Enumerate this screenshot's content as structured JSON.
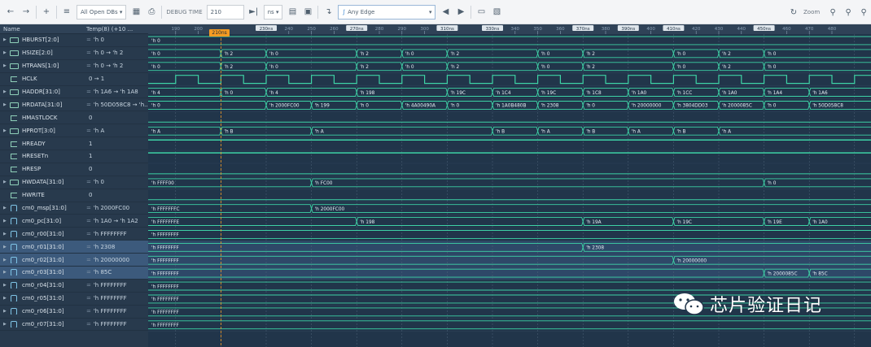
{
  "toolbar": {
    "open_dbs": "All Open DBs",
    "debug_time_label": "DEBUG TIME",
    "debug_time_value": "210",
    "unit": "ns",
    "edge_mode": "Any Edge",
    "zoom_label": "Zoom"
  },
  "header": {
    "name": "Name",
    "value": "Temp(8) (+10 ..."
  },
  "cursor": "210ns",
  "ruler_markers": [
    "230ns",
    "270ns",
    "310ns",
    "330ns",
    "370ns",
    "390ns",
    "410ns",
    "450ns"
  ],
  "ruler_ticks": [
    "190",
    "200",
    "240",
    "250",
    "260",
    "280",
    "290",
    "300",
    "340",
    "350",
    "360",
    "380",
    "400",
    "420",
    "430",
    "440",
    "460",
    "470",
    "480"
  ],
  "signals": [
    {
      "name": "HBURST[2:0]",
      "value": "'h 0",
      "kind": "bus",
      "radix": "=",
      "expand": true
    },
    {
      "name": "HSIZE[2:0]",
      "value": "'h 0 → 'h 2",
      "kind": "bus",
      "radix": "=",
      "expand": true
    },
    {
      "name": "HTRANS[1:0]",
      "value": "'h 0 → 'h 2",
      "kind": "bus",
      "radix": "=",
      "expand": true
    },
    {
      "name": "HCLK",
      "value": "0 → 1",
      "kind": "bit",
      "radix": "",
      "expand": false
    },
    {
      "name": "HADDR[31:0]",
      "value": "'h 1A6 → 'h 1A8",
      "kind": "bus",
      "radix": "=",
      "expand": true
    },
    {
      "name": "HRDATA[31:0]",
      "value": "'h 50D058C8 → 'h...",
      "kind": "bus",
      "radix": "=",
      "expand": true
    },
    {
      "name": "HMASTLOCK",
      "value": "0",
      "kind": "bit",
      "radix": "",
      "expand": false
    },
    {
      "name": "HPROT[3:0]",
      "value": "'h A",
      "kind": "bus",
      "radix": "=",
      "expand": true
    },
    {
      "name": "HREADY",
      "value": "1",
      "kind": "bit",
      "radix": "",
      "expand": false
    },
    {
      "name": "HRESETn",
      "value": "1",
      "kind": "bit",
      "radix": "",
      "expand": false
    },
    {
      "name": "HRESP",
      "value": "0",
      "kind": "bit",
      "radix": "",
      "expand": false
    },
    {
      "name": "HWDATA[31:0]",
      "value": "'h 0",
      "kind": "bus",
      "radix": "=",
      "expand": true
    },
    {
      "name": "HWRITE",
      "value": "0",
      "kind": "bit",
      "radix": "",
      "expand": false
    },
    {
      "name": "cm0_msp[31:0]",
      "value": "'h 2000FC00",
      "kind": "reg",
      "radix": "=",
      "expand": true
    },
    {
      "name": "cm0_pc[31:0]",
      "value": "'h 1A0 → 'h 1A2",
      "kind": "reg",
      "radix": "=",
      "expand": true
    },
    {
      "name": "cm0_r00[31:0]",
      "value": "'h FFFFFFFF",
      "kind": "reg",
      "radix": "=",
      "expand": true
    },
    {
      "name": "cm0_r01[31:0]",
      "value": "'h 2308",
      "kind": "reg",
      "radix": "=",
      "expand": true,
      "selected": true
    },
    {
      "name": "cm0_r02[31:0]",
      "value": "'h 20000000",
      "kind": "reg",
      "radix": "=",
      "expand": true,
      "selected": true
    },
    {
      "name": "cm0_r03[31:0]",
      "value": "'h 85C",
      "kind": "reg",
      "radix": "=",
      "expand": true,
      "selected": true
    },
    {
      "name": "cm0_r04[31:0]",
      "value": "'h FFFFFFFF",
      "kind": "reg",
      "radix": "=",
      "expand": true
    },
    {
      "name": "cm0_r05[31:0]",
      "value": "'h FFFFFFFF",
      "kind": "reg",
      "radix": "=",
      "expand": true
    },
    {
      "name": "cm0_r06[31:0]",
      "value": "'h FFFFFFFF",
      "kind": "reg",
      "radix": "=",
      "expand": true
    },
    {
      "name": "cm0_r07[31:0]",
      "value": "'h FFFFFFFF",
      "kind": "reg",
      "radix": "=",
      "expand": true
    }
  ],
  "wave_labels": {
    "HBURST[2:0]": [
      "'h 0"
    ],
    "HSIZE[2:0]": [
      "'h 0",
      "'h 2",
      "'h 0",
      "'h 2",
      "'h 0",
      "'h 2",
      "'h 0",
      "'h 2",
      "'h 0",
      "'h 2",
      "'h 0"
    ],
    "HTRANS[1:0]": [
      "'h 0",
      "'h 2",
      "'h 0",
      "'h 2",
      "'h 0",
      "'h 2",
      "'h 0",
      "'h 2",
      "'h 0",
      "'h 2",
      "'h 0"
    ],
    "HADDR[31:0]": [
      "'h 4",
      "'h 0",
      "'h 4",
      "'h 198",
      "'h 19C",
      "'h 1C4",
      "'h 19C",
      "'h 1C8",
      "'h 1A0",
      "'h 1CC",
      "'h 1A0",
      "'h 1A4",
      "'h 1A6"
    ],
    "HRDATA[31:0]": [
      "'h 0",
      "'h 2000FC00",
      "'h 199",
      "'h 0",
      "'h 4A00490A",
      "'h 0",
      "'h 1A0B480B",
      "'h 2308",
      "'h 0",
      "'h 20000000",
      "'h 3804DD03",
      "'h 2000085C",
      "'h 0",
      "'h 50D058C8"
    ],
    "HPROT[3:0]": [
      "'h A",
      "'h B",
      "'h A",
      "'h B",
      "'h A",
      "'h B",
      "'h A",
      "'h B",
      "'h A"
    ],
    "HWDATA[31:0]": [
      "'h FFFF00",
      "'h FC00",
      "'h 0"
    ],
    "cm0_msp[31:0]": [
      "'h FFFFFFFC",
      "'h 2000FC00"
    ],
    "cm0_pc[31:0]": [
      "'h FFFFFFFE",
      "'h 198",
      "'h 19A",
      "'h 19C",
      "'h 19E",
      "'h 1A0"
    ],
    "cm0_r00[31:0]": [
      "'h FFFFFFFF"
    ],
    "cm0_r01[31:0]": [
      "'h FFFFFFFF",
      "'h 2308"
    ],
    "cm0_r02[31:0]": [
      "'h FFFFFFFF",
      "'h 20000000"
    ],
    "cm0_r03[31:0]": [
      "'h FFFFFFFF",
      "'h 2000085C",
      "'h 85C"
    ],
    "cm0_r04[31:0]": [
      "'h FFFFFFFF"
    ],
    "cm0_r05[31:0]": [
      "'h FFFFFFFF"
    ],
    "cm0_r06[31:0]": [
      "'h FFFFFFFF"
    ],
    "cm0_r07[31:0]": [
      "'h FFFFFFFF"
    ]
  },
  "watermark": "芯片验证日记",
  "colors": {
    "wave": "#3ed3a6",
    "bus_text": "#e8f0f5",
    "grid": "#4f6479",
    "background": "#21354a",
    "cursor": "#f59b23"
  }
}
